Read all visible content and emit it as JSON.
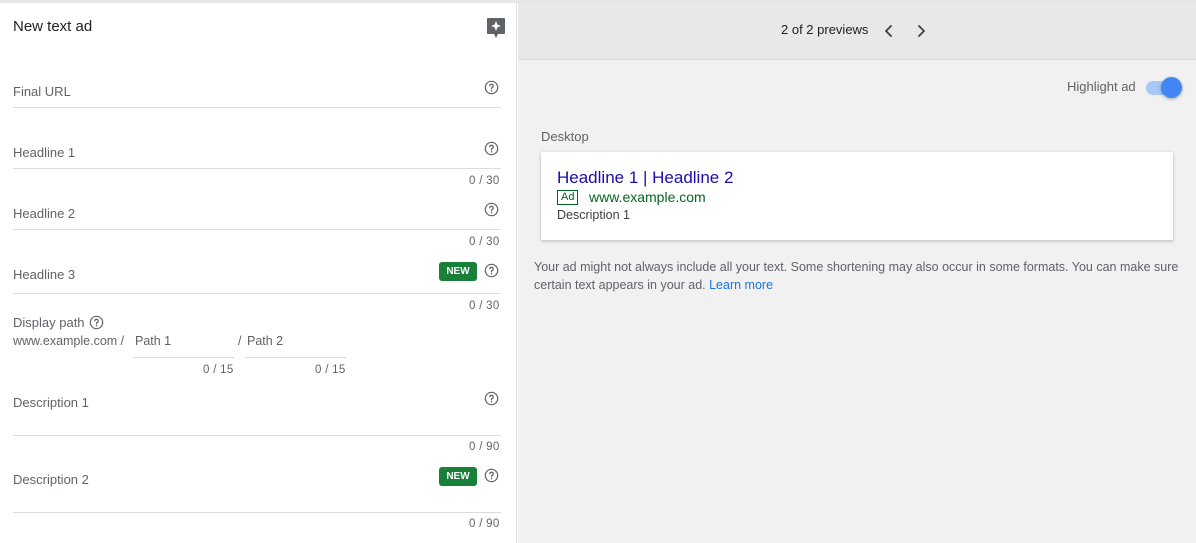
{
  "form": {
    "title": "New text ad",
    "fields": {
      "final_url": {
        "label": "Final URL"
      },
      "headline1": {
        "label": "Headline 1",
        "counter": "0 / 30"
      },
      "headline2": {
        "label": "Headline 2",
        "counter": "0 / 30"
      },
      "headline3": {
        "label": "Headline 3",
        "counter": "0 / 30",
        "badge": "NEW"
      },
      "display_path": {
        "label": "Display path",
        "domain": "www.example.com /",
        "path1_placeholder": "Path 1",
        "path1_counter": "0 / 15",
        "separator": "/",
        "path2_placeholder": "Path 2",
        "path2_counter": "0 / 15"
      },
      "description1": {
        "label": "Description 1",
        "counter": "0 / 90"
      },
      "description2": {
        "label": "Description 2",
        "counter": "0 / 90",
        "badge": "NEW"
      }
    }
  },
  "preview": {
    "count_text": "2 of 2 previews",
    "highlight_label": "Highlight ad",
    "highlight_on": true,
    "device_label": "Desktop",
    "ad": {
      "headline": "Headline 1 | Headline 2",
      "badge": "Ad",
      "url": "www.example.com",
      "description": "Description 1"
    },
    "disclaimer": "Your ad might not always include all your text. Some shortening may also occur in some formats. You can make sure certain text appears in your ad.",
    "learn_more": "Learn more"
  },
  "icons": {
    "assist": "sparkle-assist-icon",
    "help": "help-circle-icon",
    "prev": "chevron-left-icon",
    "next": "chevron-right-icon"
  },
  "colors": {
    "headline_link": "#1a0dab",
    "url_green": "#006621",
    "new_badge": "#188038",
    "toggle_blue": "#4285f4",
    "link_blue": "#1a73e8"
  }
}
